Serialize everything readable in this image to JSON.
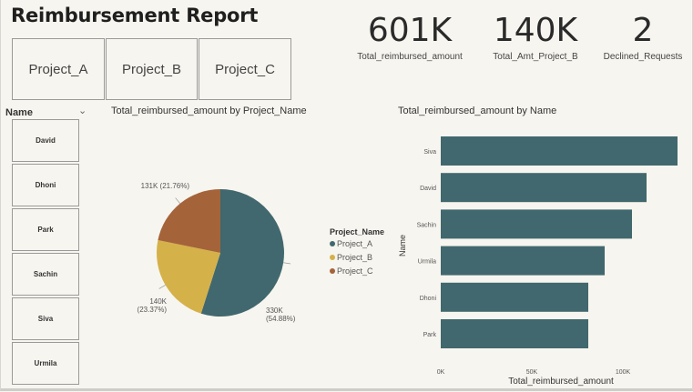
{
  "report": {
    "title": "Reimbursement Report"
  },
  "project_buttons": [
    "Project_A",
    "Project_B",
    "Project_C"
  ],
  "kpis": [
    {
      "value": "601K",
      "label": "Total_reimbursed_amount"
    },
    {
      "value": "140K",
      "label": "Total_Amt_Project_B"
    },
    {
      "value": "2",
      "label": "Declined_Requests"
    }
  ],
  "slicer": {
    "header": "Name",
    "items": [
      "David",
      "Dhoni",
      "Park",
      "Sachin",
      "Siva",
      "Urmila"
    ]
  },
  "colors": {
    "Project_A": "#41686e",
    "Project_B": "#d5b14a",
    "Project_C": "#a5633a",
    "bar": "#41686e"
  },
  "chart_data": [
    {
      "type": "pie",
      "title": "Total_reimbursed_amount by Project_Name",
      "legend_title": "Project_Name",
      "legend_placement": "right",
      "slices": [
        {
          "name": "Project_A",
          "legend_label": "Project_A",
          "value": 330,
          "percent": 54.88,
          "label_value": "330K",
          "label_pct": "(54.88%)"
        },
        {
          "name": "Project_B",
          "legend_label": "Project_B",
          "value": 140,
          "percent": 23.37,
          "label_value": "140K",
          "label_pct": "(23.37%)"
        },
        {
          "name": "Project_C",
          "legend_label": "Project_C",
          "value": 131,
          "percent": 21.76,
          "label_value": "131K",
          "label_pct": "(21.76%)"
        }
      ]
    },
    {
      "type": "bar",
      "orientation": "horizontal",
      "title": "Total_reimbursed_amount by Name",
      "xlabel": "Total_reimbursed_amount",
      "ylabel": "Name",
      "categories": [
        "Siva",
        "David",
        "Sachin",
        "Urmila",
        "Dhoni",
        "Park"
      ],
      "values": [
        130,
        113,
        105,
        90,
        81,
        81
      ],
      "xlim": [
        0,
        140
      ],
      "xticks": [
        0,
        50,
        100
      ],
      "xtick_labels": [
        "0K",
        "50K",
        "100K"
      ],
      "grid": false
    }
  ]
}
